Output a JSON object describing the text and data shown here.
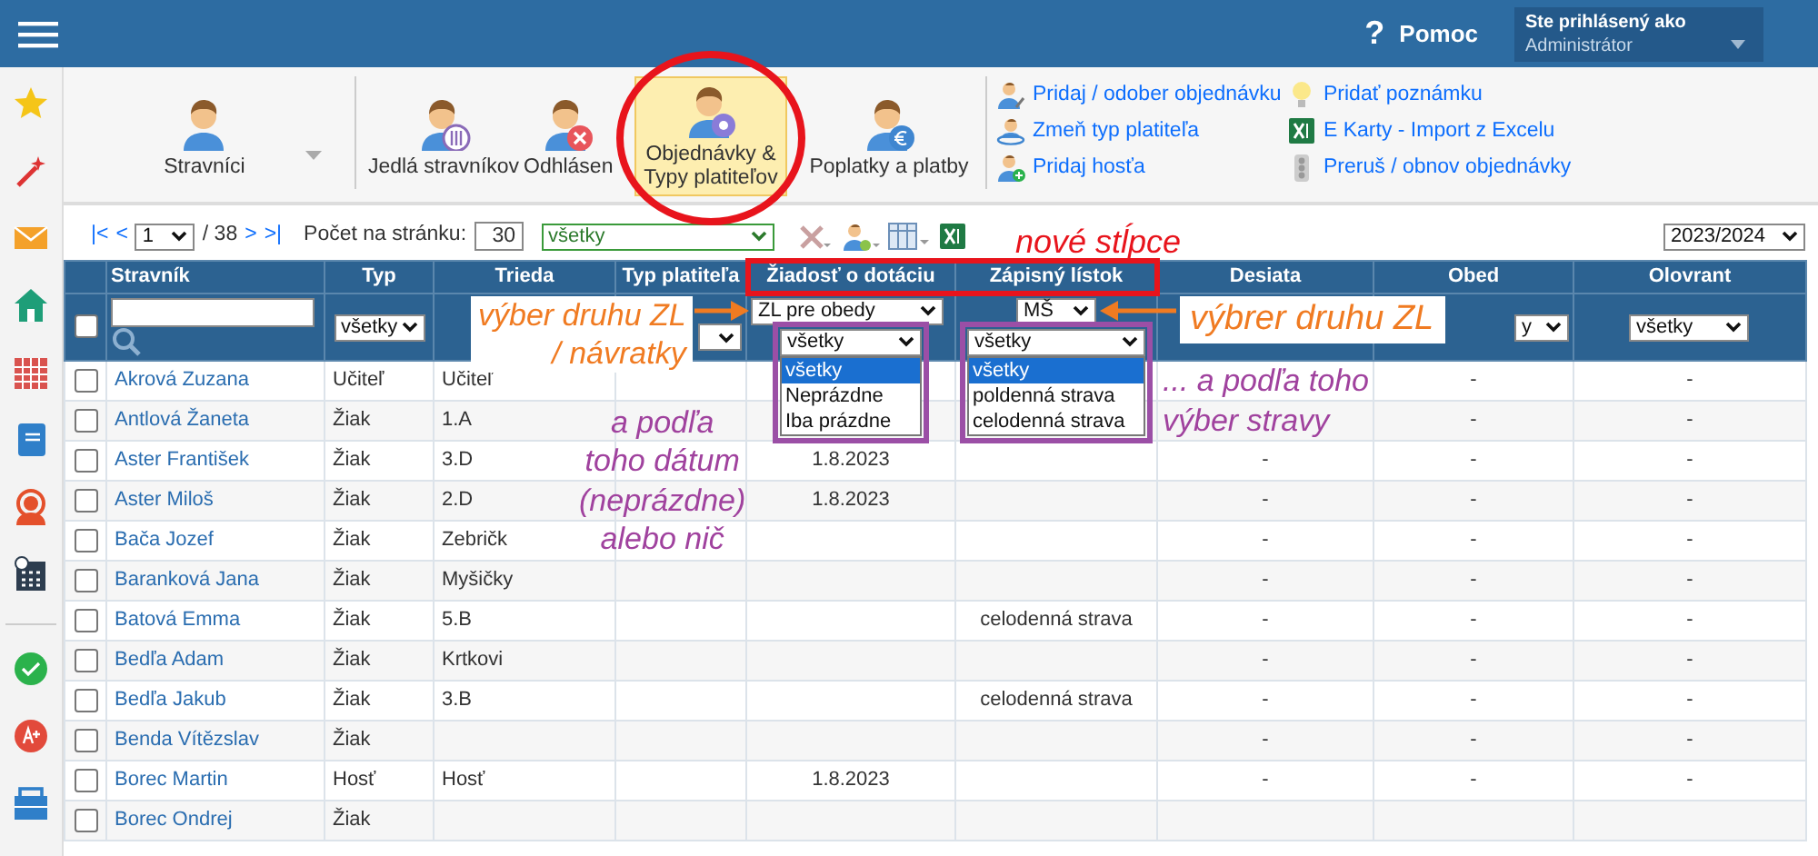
{
  "header": {
    "help_icon": "?",
    "help": "Pomoc",
    "user_label": "Ste prihlásený ako",
    "user_name": "Administrátor"
  },
  "ribbon": {
    "buttons": [
      {
        "label": "Stravníci",
        "kind": "dropdown",
        "selected": false
      },
      {
        "label": "Jedlá stravníkov",
        "kind": "button",
        "selected": false
      },
      {
        "label": "Odhlásen",
        "kind": "button",
        "selected": false
      },
      {
        "label": "Objednávky & Typy platiteľov",
        "kind": "button",
        "selected": true
      },
      {
        "label": "Poplatky a platby",
        "kind": "button",
        "selected": false
      }
    ],
    "actions": [
      "Pridaj / odober objednávku",
      "Zmeň typ platiteľa",
      "Pridaj hosťa",
      "Pridať poznámku",
      "E Karty - Import z Excelu",
      "Preruš / obnov objednávky"
    ]
  },
  "toolbar": {
    "first": "|<",
    "prev": "<",
    "page": "1",
    "page_total": "/ 38",
    "next": ">",
    "last": ">|",
    "per_page_label": "Počet na stránku:",
    "per_page": "30",
    "filter": "všetky",
    "year": "2023/2024"
  },
  "table": {
    "columns": [
      "Stravník",
      "Typ",
      "Trieda",
      "Typ platiteľa",
      "Žiadosť o dotáciu",
      "Zápisný lístok",
      "Desiata",
      "Obed",
      "Olovrant"
    ],
    "select_all": {
      "checked": false
    },
    "filters": {
      "type": "všetky",
      "request_kind": "ZL pre obedy",
      "request_state": "všetky",
      "enrollment_kind": "MŠ",
      "enrollment_meal": "všetky",
      "lunch": "y",
      "afternoon_snack": "všetky"
    },
    "request_options": [
      {
        "label": "všetky",
        "selected": true
      },
      {
        "label": "Neprázdne",
        "selected": false
      },
      {
        "label": "Iba prázdne",
        "selected": false
      }
    ],
    "enrollment_options": [
      {
        "label": "všetky",
        "selected": true
      },
      {
        "label": "poldenná strava",
        "selected": false
      },
      {
        "label": "celodenná strava",
        "selected": false
      }
    ],
    "rows": [
      {
        "checked": false,
        "name": "Akrová Zuzana",
        "type": "Učiteľ",
        "class": "Učiteľ",
        "lunch": "-",
        "afternoon_snack": "-"
      },
      {
        "checked": false,
        "name": "Antlová Žaneta",
        "type": "Žiak",
        "class": "1.A",
        "lunch": "-",
        "afternoon_snack": "-"
      },
      {
        "checked": false,
        "name": "Aster František",
        "type": "Žiak",
        "class": "3.D",
        "request": "1.8.2023",
        "snack": "-",
        "lunch": "-",
        "afternoon_snack": "-"
      },
      {
        "checked": false,
        "name": "Aster Miloš",
        "type": "Žiak",
        "class": "2.D",
        "request": "1.8.2023",
        "snack": "-",
        "lunch": "-",
        "afternoon_snack": "-"
      },
      {
        "checked": false,
        "name": "Bača Jozef",
        "type": "Žiak",
        "class": "Zebričk",
        "snack": "-",
        "lunch": "-",
        "afternoon_snack": "-"
      },
      {
        "checked": false,
        "name": "Baranková Jana",
        "type": "Žiak",
        "class": "Myšičky",
        "snack": "-",
        "lunch": "-",
        "afternoon_snack": "-"
      },
      {
        "checked": false,
        "name": "Batová Emma",
        "type": "Žiak",
        "class": "5.B",
        "enrollment": "celodenná strava",
        "snack": "-",
        "lunch": "-",
        "afternoon_snack": "-"
      },
      {
        "checked": false,
        "name": "Bedľa Adam",
        "type": "Žiak",
        "class": "Krtkovi",
        "snack": "-",
        "lunch": "-",
        "afternoon_snack": "-"
      },
      {
        "checked": false,
        "name": "Bedľa Jakub",
        "type": "Žiak",
        "class": "3.B",
        "enrollment": "celodenná strava",
        "snack": "-",
        "lunch": "-",
        "afternoon_snack": "-"
      },
      {
        "checked": false,
        "name": "Benda Vítězslav",
        "type": "Žiak",
        "snack": "-",
        "lunch": "-",
        "afternoon_snack": "-"
      },
      {
        "checked": false,
        "name": "Borec Martin",
        "type": "Hosť",
        "class": "Hosť",
        "request": "1.8.2023",
        "snack": "-",
        "lunch": "-",
        "afternoon_snack": "-"
      },
      {
        "checked": false,
        "name": "Borec Ondrej",
        "type": "Žiak"
      }
    ]
  },
  "annotations": [
    {
      "kind": "circle",
      "color": "#e8141c"
    },
    {
      "kind": "text",
      "color": "#e8141c",
      "text": "nové stĺpce"
    },
    {
      "kind": "rect",
      "color": "#e8141c"
    },
    {
      "kind": "text",
      "color": "#f07b22",
      "text": "výber druhu ZL\n/ návratky"
    },
    {
      "kind": "arrow",
      "color": "#f07b22"
    },
    {
      "kind": "rect",
      "color": "#9b4fa6"
    },
    {
      "kind": "rect",
      "color": "#9b4fa6"
    },
    {
      "kind": "text",
      "color": "#f07b22",
      "text": "výbrer druhu ZL"
    },
    {
      "kind": "arrow",
      "color": "#f07b22"
    },
    {
      "kind": "text",
      "color": "#a0429e",
      "text": "a podľa\ntoho dátum\n(neprázdne)\nalebo nič"
    },
    {
      "kind": "text",
      "color": "#a0429e",
      "text": "... a podľa toho\nvýber stravy"
    }
  ]
}
